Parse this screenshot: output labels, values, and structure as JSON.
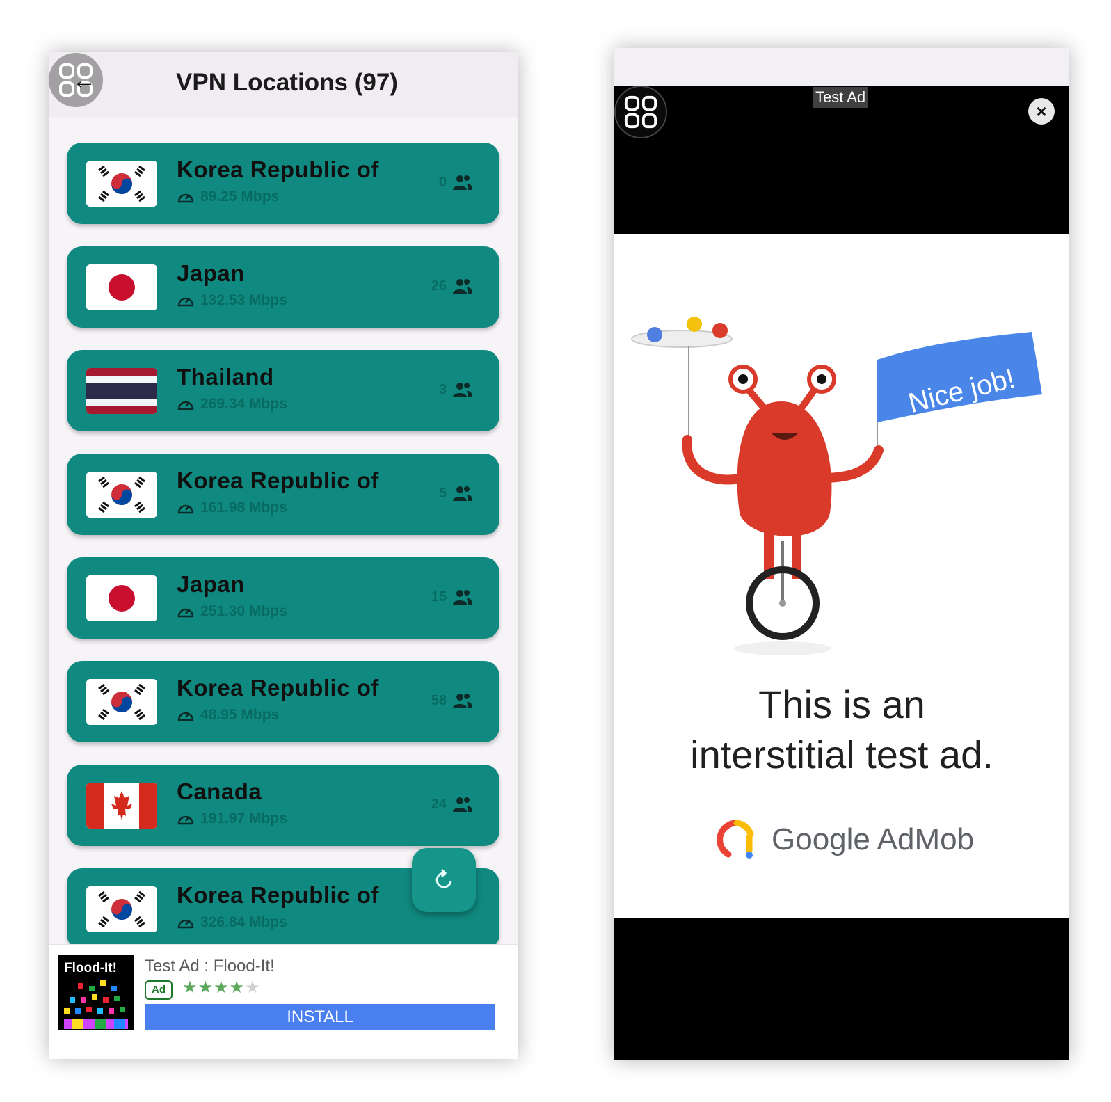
{
  "left_screen": {
    "title": "VPN Locations (97)",
    "locations": [
      {
        "country": "Korea Republic of",
        "speed": "89.25 Mbps",
        "users": "0",
        "flag": "kr"
      },
      {
        "country": "Japan",
        "speed": "132.53 Mbps",
        "users": "26",
        "flag": "jp"
      },
      {
        "country": "Thailand",
        "speed": "269.34 Mbps",
        "users": "3",
        "flag": "th"
      },
      {
        "country": "Korea Republic of",
        "speed": "161.98 Mbps",
        "users": "5",
        "flag": "kr"
      },
      {
        "country": "Japan",
        "speed": "251.30 Mbps",
        "users": "15",
        "flag": "jp"
      },
      {
        "country": "Korea Republic of",
        "speed": "48.95 Mbps",
        "users": "58",
        "flag": "kr"
      },
      {
        "country": "Canada",
        "speed": "191.97 Mbps",
        "users": "24",
        "flag": "ca"
      },
      {
        "country": "Korea Republic of",
        "speed": "326.84 Mbps",
        "users": "",
        "flag": "kr"
      }
    ],
    "ad_banner": {
      "thumb_title": "Flood-It!",
      "title": "Test Ad : Flood-It!",
      "badge": "Ad",
      "rating": 4,
      "rating_max": 5,
      "install_label": "INSTALL"
    },
    "colors": {
      "card": "#108a80",
      "header": "#f0ecf2",
      "install": "#4a7ff0"
    }
  },
  "right_screen": {
    "test_ad_label": "Test Ad",
    "close_label": "×",
    "flag_text": "Nice job!",
    "headline_line1": "This is an",
    "headline_line2": "interstitial test ad.",
    "brand": "Google AdMob"
  }
}
